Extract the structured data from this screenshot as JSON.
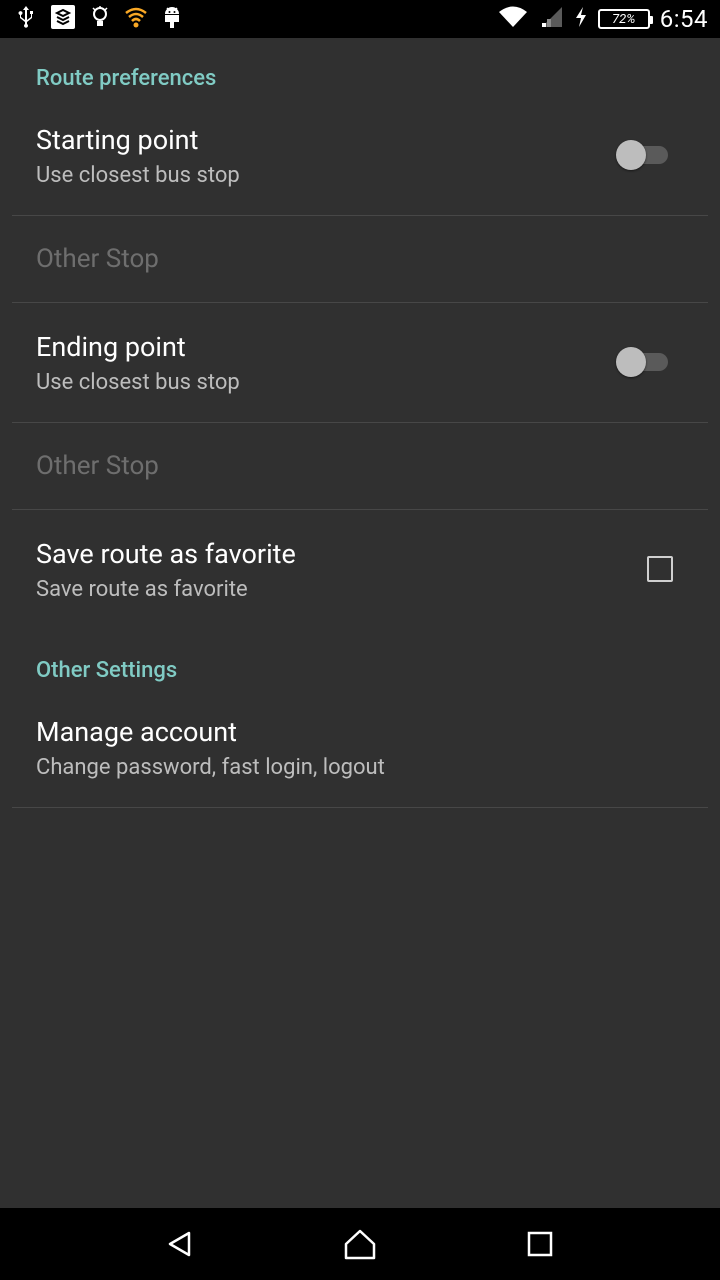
{
  "status_bar": {
    "time": "6:54",
    "battery_percent": "72%",
    "left_icons": [
      "usb-icon",
      "notification-app-icon",
      "lightbulb-icon",
      "wifi-hotspot-icon",
      "android-icon"
    ],
    "right_icons": [
      "wifi-icon",
      "signal-icon",
      "charging-icon",
      "battery-icon"
    ]
  },
  "sections": {
    "route_preferences": "Route preferences",
    "other_settings": "Other Settings"
  },
  "prefs": {
    "starting_point": {
      "title": "Starting point",
      "summary": "Use closest bus stop",
      "enabled": false
    },
    "starting_other": "Other Stop",
    "ending_point": {
      "title": "Ending point",
      "summary": "Use closest bus stop",
      "enabled": false
    },
    "ending_other": "Other Stop",
    "save_favorite": {
      "title": "Save route as favorite",
      "summary": "Save route as favorite",
      "checked": false
    },
    "manage_account": {
      "title": "Manage account",
      "summary": "Change password, fast login, logout"
    }
  },
  "nav_bar": {
    "buttons": [
      "back-icon",
      "home-icon",
      "recents-icon"
    ]
  },
  "colors": {
    "background": "#303030",
    "accent": "#80cbc4",
    "status_bar": "#000000"
  }
}
